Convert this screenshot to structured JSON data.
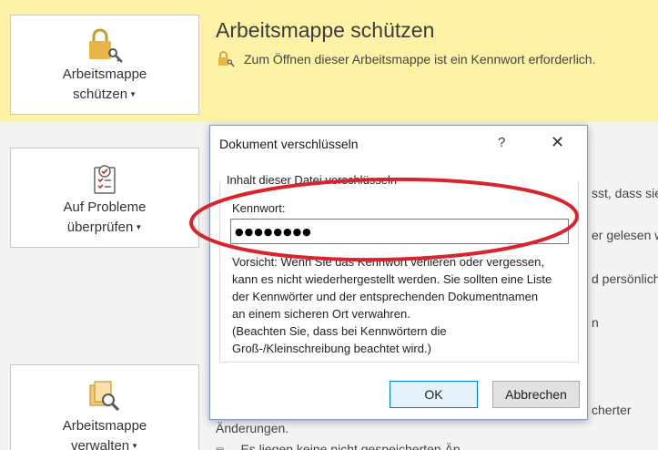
{
  "protect": {
    "button_line1": "Arbeitsmappe",
    "button_line2": "schützen",
    "title": "Arbeitsmappe schützen",
    "description": "Zum Öffnen dieser Arbeitsmappe ist ein Kennwort erforderlich."
  },
  "check": {
    "button_line1": "Auf Probleme",
    "button_line2": "überprüfen"
  },
  "manage": {
    "button_line1": "Arbeitsmappe",
    "button_line2": "verwalten"
  },
  "background_fragments": {
    "f1": "sst, dass sie",
    "f2": "er gelesen w",
    "f3": "d persönlich",
    "f4": "n",
    "f5": "cherter",
    "f6": "Änderungen.",
    "f7": "Es liegen keine nicht gespeicherten Än"
  },
  "dialog": {
    "title": "Dokument verschlüsseln",
    "help": "?",
    "close": "✕",
    "group_label": "Inhalt dieser Datei verschlüsseln",
    "password_label": "Kennwort:",
    "password_value": "●●●●●●●●",
    "warning_lines": [
      "Vorsicht: Wenn Sie das Kennwort verlieren oder vergessen,",
      "kann es nicht wiederhergestellt werden. Sie sollten eine Liste",
      "der Kennwörter und der entsprechenden Dokumentnamen",
      "an einem sicheren Ort verwahren.",
      "(Beachten Sie, dass bei Kennwörtern die",
      "Groß-/Kleinschreibung beachtet wird.)"
    ],
    "ok_label": "OK",
    "cancel_label": "Abbrechen"
  },
  "colors": {
    "band": "#fdf2a5",
    "annotation": "#d9242c",
    "accent": "#0078d7"
  },
  "icons": {
    "protect": "lock-key-icon",
    "check": "checklist-icon",
    "manage": "documents-search-icon"
  }
}
